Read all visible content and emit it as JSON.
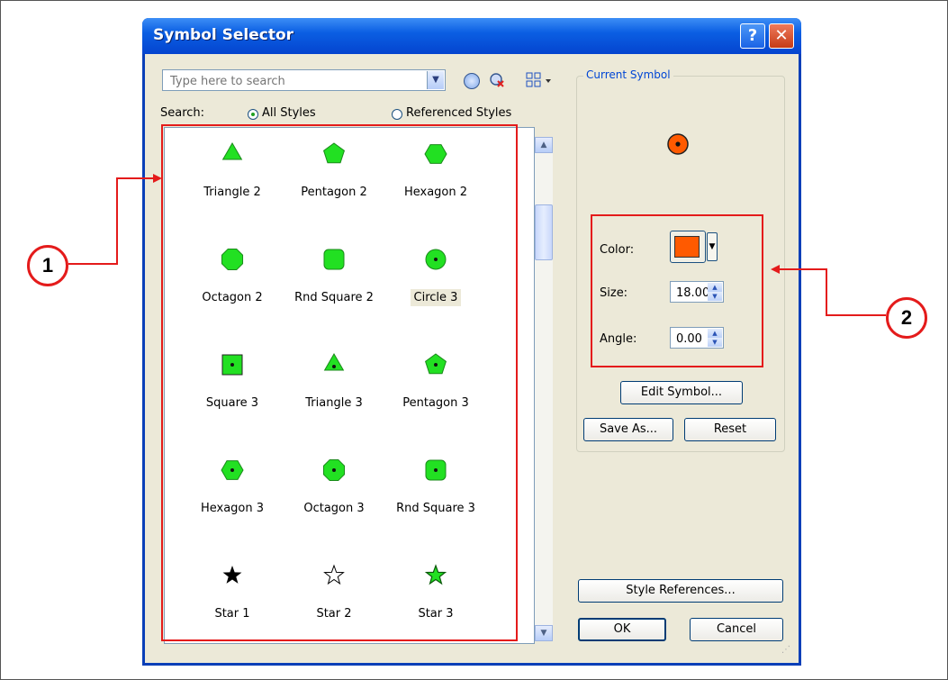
{
  "dialog": {
    "title": "Symbol Selector",
    "help_label": "?",
    "close_label": "✕"
  },
  "search": {
    "placeholder": "Type here to search",
    "label": "Search:",
    "option_all": "All Styles",
    "option_referenced": "Referenced Styles",
    "selected_option": "All Styles"
  },
  "symbols": [
    {
      "name": "Triangle 2",
      "shape": "triangle",
      "dot": false,
      "selected": false
    },
    {
      "name": "Pentagon 2",
      "shape": "pentagon",
      "dot": false,
      "selected": false
    },
    {
      "name": "Hexagon 2",
      "shape": "hexagon",
      "dot": false,
      "selected": false
    },
    {
      "name": "Octagon 2",
      "shape": "octagon",
      "dot": false,
      "selected": false
    },
    {
      "name": "Rnd Square 2",
      "shape": "rndsquare",
      "dot": false,
      "selected": false
    },
    {
      "name": "Circle 3",
      "shape": "circle",
      "dot": true,
      "selected": true
    },
    {
      "name": "Square 3",
      "shape": "square",
      "dot": true,
      "selected": false
    },
    {
      "name": "Triangle 3",
      "shape": "triangle",
      "dot": true,
      "selected": false
    },
    {
      "name": "Pentagon 3",
      "shape": "pentagon",
      "dot": true,
      "selected": false
    },
    {
      "name": "Hexagon 3",
      "shape": "hexagon",
      "dot": true,
      "selected": false
    },
    {
      "name": "Octagon 3",
      "shape": "octagon",
      "dot": true,
      "selected": false
    },
    {
      "name": "Rnd Square 3",
      "shape": "rndsquare",
      "dot": true,
      "selected": false
    },
    {
      "name": "Star 1",
      "shape": "star-black",
      "dot": false,
      "selected": false
    },
    {
      "name": "Star 2",
      "shape": "star-outline",
      "dot": false,
      "selected": false
    },
    {
      "name": "Star 3",
      "shape": "star-green",
      "dot": false,
      "selected": false
    }
  ],
  "current_symbol": {
    "title": "Current Symbol",
    "color_label": "Color:",
    "color_value": "#ff5a00",
    "size_label": "Size:",
    "size_value": "18.00",
    "angle_label": "Angle:",
    "angle_value": "0.00"
  },
  "buttons": {
    "edit_symbol": "Edit Symbol...",
    "save_as": "Save As...",
    "reset": "Reset",
    "style_references": "Style References...",
    "ok": "OK",
    "cancel": "Cancel"
  },
  "callouts": {
    "one": "1",
    "two": "2"
  },
  "colors": {
    "symbol_fill": "#22e022",
    "annotation_red": "#e41b1b",
    "titlebar_blue": "#0b5fe3"
  }
}
